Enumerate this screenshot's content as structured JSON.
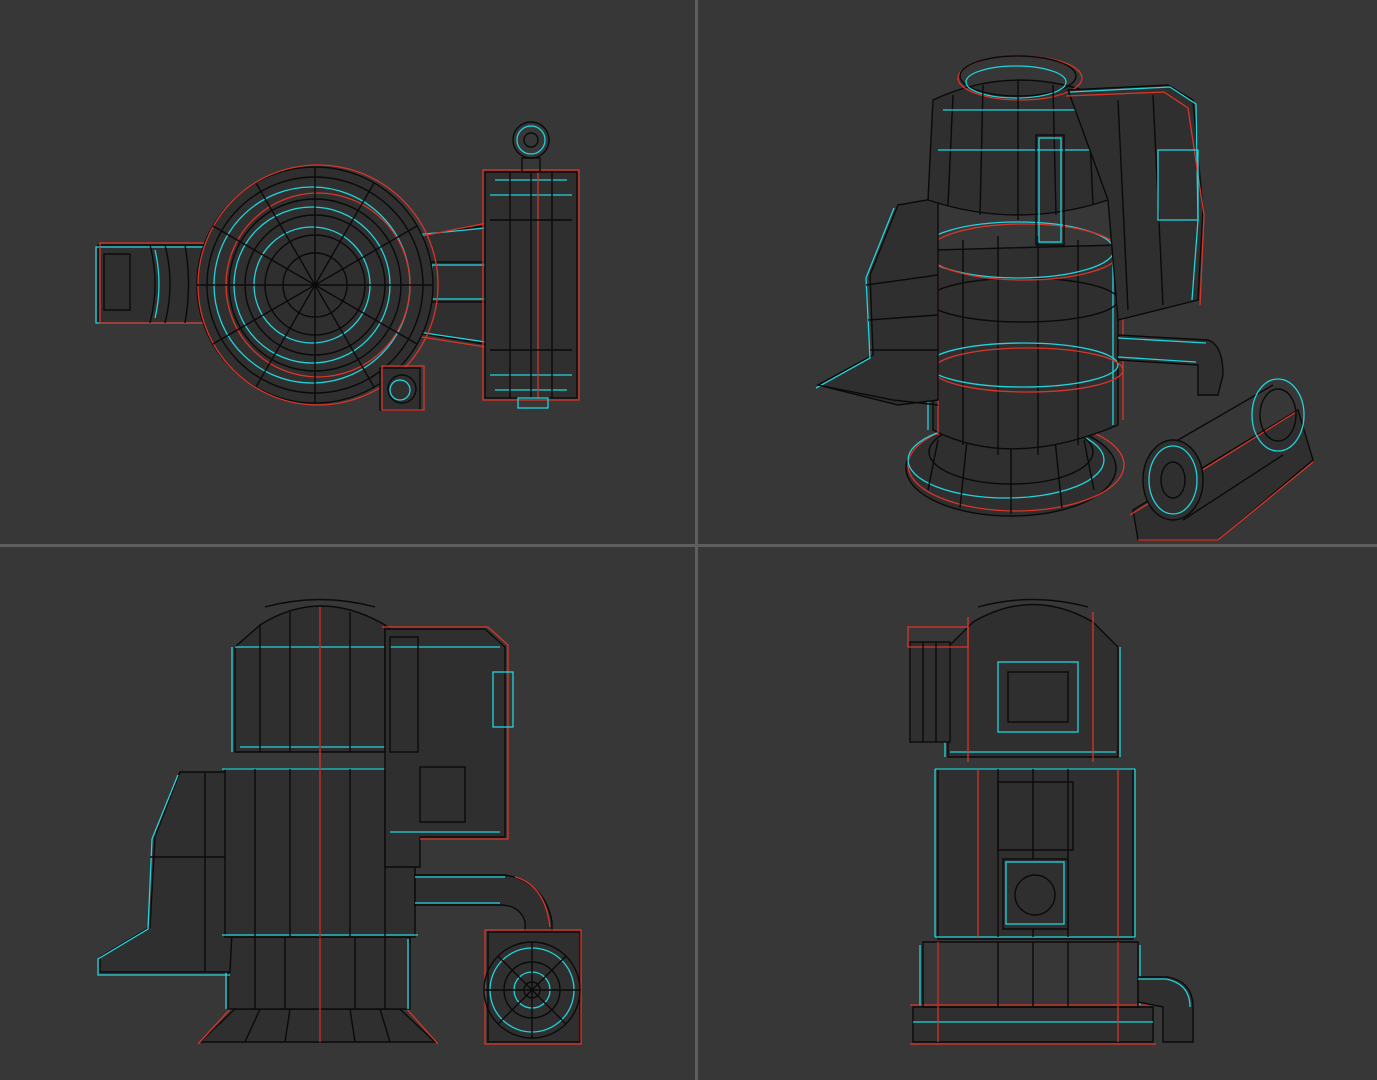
{
  "viewports": [
    {
      "id": "top",
      "label": ""
    },
    {
      "id": "perspective",
      "label": ""
    },
    {
      "id": "front",
      "label": ""
    },
    {
      "id": "side",
      "label": ""
    }
  ],
  "colors": {
    "background": "#373737",
    "divider": "#5e5e5e",
    "wire_black": "#0a0a0a",
    "wire_red": "#d8352a",
    "wire_cyan": "#22d3dc"
  }
}
